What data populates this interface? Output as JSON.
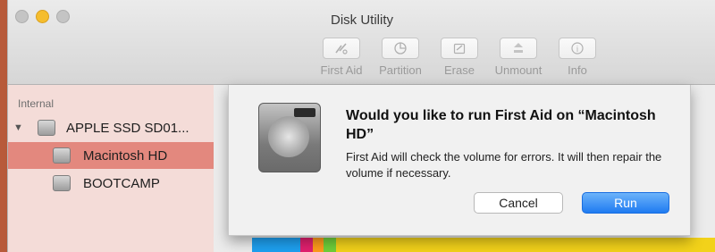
{
  "window": {
    "title": "Disk Utility"
  },
  "toolbar": {
    "items": [
      {
        "label": "First Aid",
        "icon": "first-aid-icon"
      },
      {
        "label": "Partition",
        "icon": "partition-icon"
      },
      {
        "label": "Erase",
        "icon": "erase-icon"
      },
      {
        "label": "Unmount",
        "icon": "unmount-icon"
      },
      {
        "label": "Info",
        "icon": "info-icon"
      }
    ]
  },
  "sidebar": {
    "section_label": "Internal",
    "items": [
      {
        "label": "APPLE SSD SD01...",
        "expanded": true,
        "selected": false
      },
      {
        "label": "Macintosh HD",
        "selected": true
      },
      {
        "label": "BOOTCAMP",
        "selected": false
      }
    ]
  },
  "dialog": {
    "question": "Would you like to run First Aid on “Macintosh HD”",
    "description": "First Aid will check the volume for errors. It will then repair the volume if necessary.",
    "cancel_label": "Cancel",
    "run_label": "Run"
  },
  "colors": {
    "selection": "#e3887e",
    "sidebar_bg": "#f4dcd8",
    "primary_button": "#1f7bf1",
    "usage_bar": [
      "#1ea0f0",
      "#e2206f",
      "#ff9b1c",
      "#6fcf3a",
      "#f2d21a"
    ]
  }
}
